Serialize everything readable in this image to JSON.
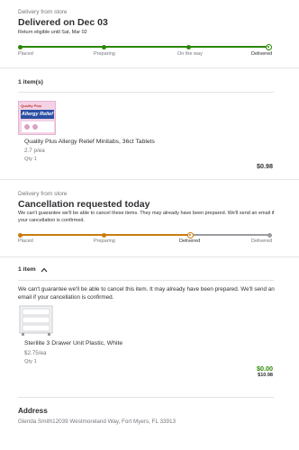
{
  "order1": {
    "fulfillment_label": "Delivery from store",
    "status_title": "Delivered on Dec 03",
    "return_note": "Return eligible until Sat, Mar 02",
    "steps": [
      "Placed",
      "Preparing",
      "On the way",
      "Delivered"
    ],
    "progress_fraction": 1.0,
    "items_count_label": "1 item(s)",
    "item": {
      "image_text_top": "Quality Plus",
      "image_text_main": "Allergy Relief",
      "name": "Quality Plus Allergy Relief Minitabs, 36ct Tablets",
      "price_each": "2.7 p/ea",
      "qty": "Qty 1",
      "total": "$0.98"
    }
  },
  "order2": {
    "fulfillment_label": "Delivery from store",
    "status_title": "Cancellation requested today",
    "notice": "We can't guarantee we'll be able to cancel these items. They may already have been prepared. We'll send an email if your cancellation is confirmed.",
    "steps": [
      "Placed",
      "Preparing",
      "Delivered",
      "Delivered"
    ],
    "progress_fraction": 0.68,
    "items_toggle_label": "1 item",
    "item_notice": "We can't guarantee we'll be able to cancel this item. It may already have been prepared. We'll send an email if your cancellation is confirmed.",
    "item": {
      "name": "Sterilite 3 Drawer Unit Plastic, White",
      "price_each": "$2.75/ea",
      "qty": "Qty 1",
      "total_green": "$0.00",
      "total_strike": "$10.98"
    }
  },
  "address": {
    "title": "Address",
    "line": "Glenda Smith12039 Westmoreland Way, Fort Myers, FL 33913"
  },
  "colors": {
    "green": "#2a8703",
    "orange": "#c97b0e",
    "grey": "#9a9ba0"
  }
}
